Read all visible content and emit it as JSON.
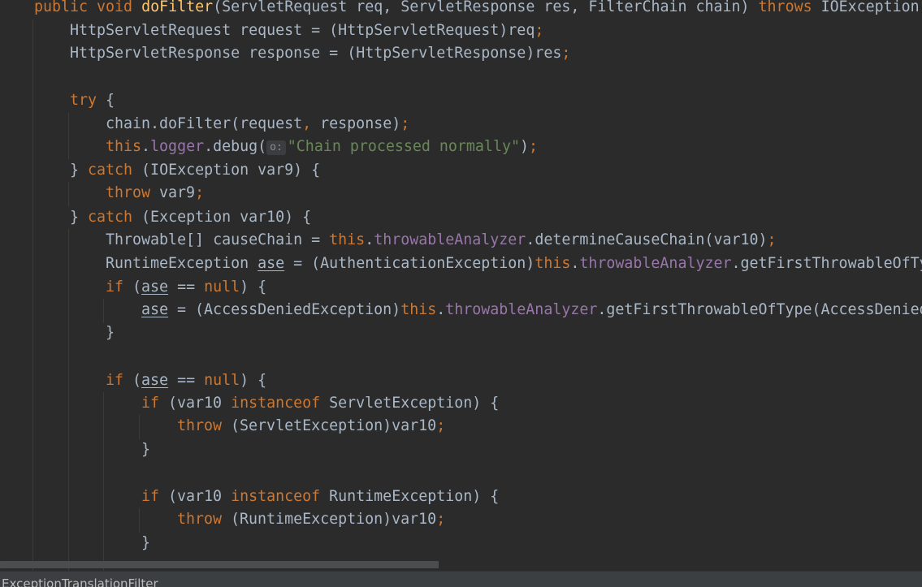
{
  "breadcrumb": "ExceptionTranslationFilter",
  "code": {
    "method_kw": "public void",
    "method_name": "doFilter",
    "params": "(ServletRequest req, ServletResponse res, FilterChain chain) ",
    "throws_kw": "throws",
    "throws_type": " IOException",
    "line2": "HttpServletRequest request = (HttpServletRequest)req",
    "line3": "HttpServletResponse response = (HttpServletResponse)res",
    "try_kw": "try",
    "chain_call": "chain.doFilter(request",
    "chain_args": " response)",
    "this_kw": "this",
    "logger_field": "logger",
    "debug_call": ".debug(",
    "param_hint": "o:",
    "log_message": "\"Chain processed normally\"",
    "catch_kw": "catch",
    "catch1_args": " (IOException var9) {",
    "throw_kw": "throw",
    "throw_var9": " var9",
    "catch2_args": " (Exception var10) {",
    "cause_chain_decl": "Throwable[] causeChain = ",
    "analyzer_field": "throwableAnalyzer",
    "determine_call": ".determineCauseChain(var10)",
    "runtime_decl": "RuntimeException ",
    "ase_var": "ase",
    "auth_cast": " = (AuthenticationException)",
    "get_first_call": ".getFirstThrowableOfTy",
    "if_kw": "if",
    "null_kw": "null",
    "access_cast": " = (AccessDeniedException)",
    "get_first_call_2": ".getFirstThrowableOfType(AccessDenied",
    "instanceof_kw": "instanceof",
    "servlet_exc": " ServletException) {",
    "cast_servlet": " (ServletException)var10",
    "runtime_exc": " RuntimeException) {",
    "cast_runtime": " (RuntimeException)var10"
  }
}
